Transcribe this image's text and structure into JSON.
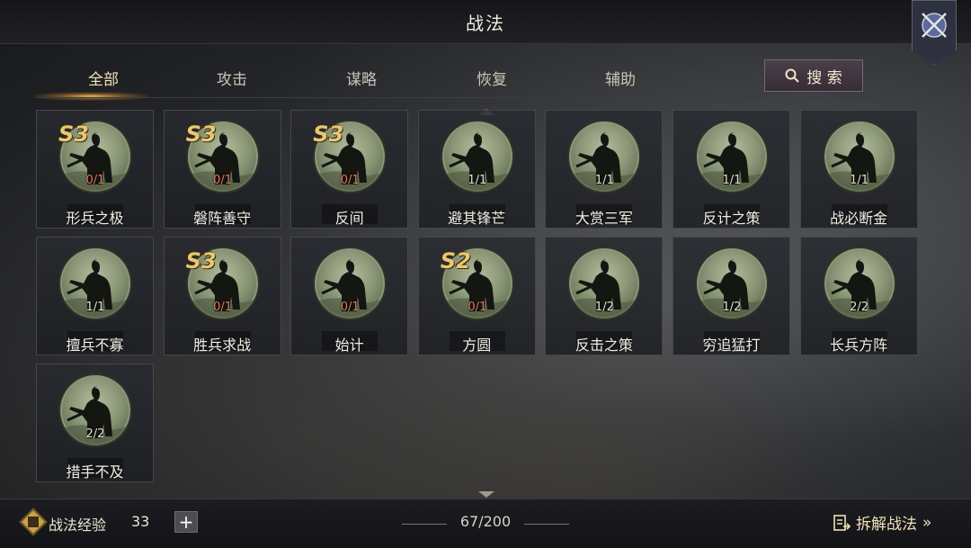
{
  "header": {
    "title": "战法"
  },
  "tabs": [
    {
      "label": "全部",
      "active": true
    },
    {
      "label": "攻击",
      "active": false
    },
    {
      "label": "谋略",
      "active": false
    },
    {
      "label": "恢复",
      "active": false
    },
    {
      "label": "辅助",
      "active": false
    }
  ],
  "search": {
    "label": "搜 索"
  },
  "tactics": [
    {
      "name": "形兵之极",
      "count": "0/1",
      "grade": "S3",
      "low": true
    },
    {
      "name": "磐阵善守",
      "count": "0/1",
      "grade": "S3",
      "low": true
    },
    {
      "name": "反间",
      "count": "0/1",
      "grade": "S3",
      "low": true
    },
    {
      "name": "避其锋芒",
      "count": "1/1",
      "grade": "",
      "low": false
    },
    {
      "name": "大赏三军",
      "count": "1/1",
      "grade": "",
      "low": false
    },
    {
      "name": "反计之策",
      "count": "1/1",
      "grade": "",
      "low": false
    },
    {
      "name": "战必断金",
      "count": "1/1",
      "grade": "",
      "low": false
    },
    {
      "name": "擅兵不寡",
      "count": "1/1",
      "grade": "",
      "low": false
    },
    {
      "name": "胜兵求战",
      "count": "0/1",
      "grade": "S3",
      "low": true
    },
    {
      "name": "始计",
      "count": "0/1",
      "grade": "",
      "low": true
    },
    {
      "name": "方圆",
      "count": "0/1",
      "grade": "S2",
      "low": true
    },
    {
      "name": "反击之策",
      "count": "1/2",
      "grade": "",
      "low": false
    },
    {
      "name": "穷追猛打",
      "count": "1/2",
      "grade": "",
      "low": false
    },
    {
      "name": "长兵方阵",
      "count": "2/2",
      "grade": "",
      "low": false
    },
    {
      "name": "措手不及",
      "count": "2/2",
      "grade": "",
      "low": false
    }
  ],
  "footer": {
    "exp_label": "战法经验",
    "exp_value": "33",
    "plus_label": "+",
    "total": "67/200",
    "dismantle_label": "拆解战法",
    "dismantle_arrow": "»"
  },
  "colors": {
    "accent": "#e8c872",
    "low_count": "#e07a62"
  }
}
